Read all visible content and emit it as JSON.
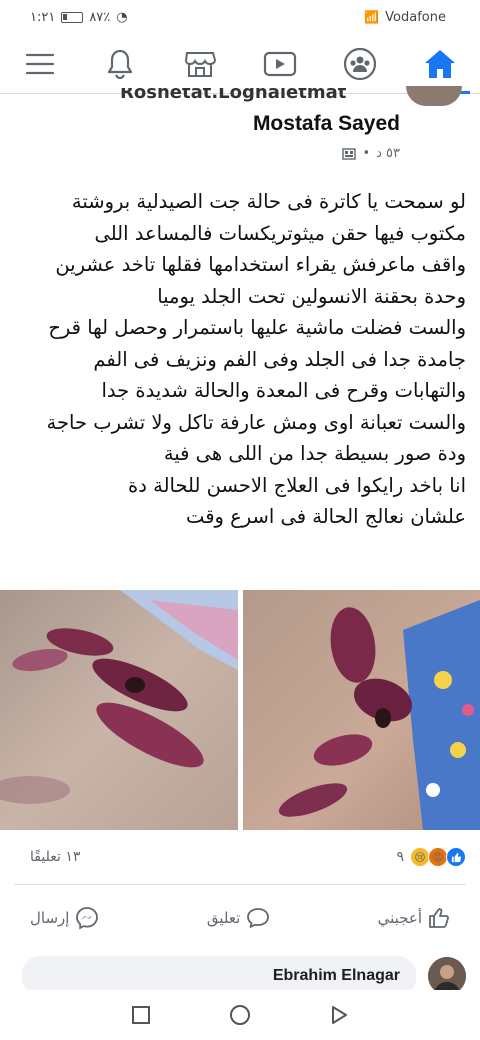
{
  "status_bar": {
    "time": "١:٢١",
    "battery": "٨٧٪",
    "carrier": "Vodafone"
  },
  "nav": {
    "items": [
      {
        "icon": "menu-icon"
      },
      {
        "icon": "bell-icon"
      },
      {
        "icon": "marketplace-icon"
      },
      {
        "icon": "video-icon"
      },
      {
        "icon": "groups-icon"
      },
      {
        "icon": "home-icon"
      }
    ],
    "accent": "#1877f2"
  },
  "post": {
    "cut_name": "Roshetat.Loghaletmat",
    "author": "Mostafa Sayed",
    "time": "٥٣ د",
    "body_lines": [
      "لو سمحت يا كاترة فى حالة جت الصيدلية بروشتة",
      "مكتوب فيها حقن ميثوتريكسات فالمساعد اللى",
      "واقف ماعرفش يقراء  استخدامها فقلها تاخد عشرين",
      "وحدة بحقنة الانسولين تحت الجلد يوميا",
      "والست فضلت ماشية عليها باستمرار وحصل لها قرح",
      "جامدة جدا فى الجلد وفى الفم ونزيف فى الفم",
      "والتهابات وقرح فى المعدة والحالة شديدة جدا",
      "والست تعبانة اوى ومش عارفة تاكل ولا تشرب حاجة",
      "ودة صور بسيطة جدا من اللى هى فية",
      "انا باخد رايكوا فى العلاج الاحسن للحالة دة",
      "علشان نعالج الحالة فى اسرع وقت"
    ],
    "comments_count": "١٣ تعليقًا",
    "reactions_count": "٩"
  },
  "actions": {
    "like": "أعجبني",
    "comment": "تعليق",
    "share": "إرسال"
  },
  "comment_preview": {
    "author": "Ebrahim Elnagar"
  }
}
